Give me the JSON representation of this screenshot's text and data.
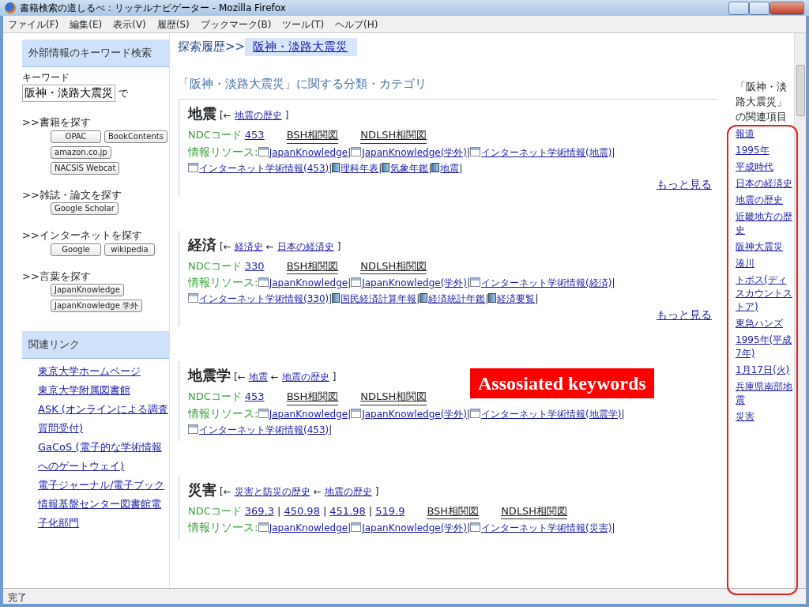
{
  "window": {
    "title": "書籍検索の道しるべ：リッテルナビゲーター - Mozilla Firefox"
  },
  "menu": [
    "ファイル(F)",
    "編集(E)",
    "表示(V)",
    "履歴(S)",
    "ブックマーク(B)",
    "ツール(T)",
    "ヘルプ(H)"
  ],
  "sidebar": {
    "search_heading": "外部情報のキーワード検索",
    "keyword_label": "キーワード",
    "keyword_value": "阪神・淡路大震災",
    "keyword_suffix": "で",
    "sections": [
      {
        "heading": ">>書籍を探す",
        "buttons": [
          "OPAC",
          "BookContents",
          "amazon.co.jp",
          "NACSIS Webcat"
        ]
      },
      {
        "heading": ">>雑誌・論文を探す",
        "buttons": [
          "Google Scholar"
        ]
      },
      {
        "heading": ">>インターネットを探す",
        "buttons": [
          "Google",
          "wikipedia"
        ]
      },
      {
        "heading": ">>言葉を探す",
        "buttons": [
          "JapanKnowledge",
          "JapanKnowledge 学外"
        ]
      }
    ],
    "links_heading": "関連リンク",
    "links": [
      "東京大学ホームページ",
      "東京大学附属図書館",
      "ASK (オンラインによる調査質問受付)",
      "GaCoS (電子的な学術情報へのゲートウェイ)",
      "電子ジャーナル/電子ブック",
      "情報基盤センター図書館電子化部門"
    ]
  },
  "main": {
    "breadcrumb_label": "探索履歴>>",
    "breadcrumb_current": "阪神・淡路大震災",
    "section_title": "「阪神・淡路大震災」に関する分類・カテゴリ",
    "path_open": "[←",
    "path_arrow": "←",
    "path_close": "]",
    "separator": "|",
    "categories": [
      {
        "title": "地震",
        "path": [
          "地震の歴史"
        ],
        "ndc_label": "NDCコード",
        "ndc_codes": [
          "453"
        ],
        "bsh": "BSH相関図",
        "ndlsh": "NDLSH相関図",
        "resources_label": "情報リソース:",
        "resources": [
          {
            "kind": "web",
            "label": "JapanKnowledge"
          },
          {
            "kind": "web",
            "label": "JapanKnowledge(学外)"
          },
          {
            "kind": "web",
            "label": "インターネット学術情報(地震)"
          },
          {
            "kind": "web",
            "label": "インターネット学術情報(453)"
          },
          {
            "kind": "book",
            "label": "理科年表"
          },
          {
            "kind": "book",
            "label": "気象年鑑"
          },
          {
            "kind": "book",
            "label": "地震"
          }
        ],
        "more": "もっと見る"
      },
      {
        "title": "経済",
        "path": [
          "経済史",
          "日本の経済史"
        ],
        "ndc_label": "NDCコード",
        "ndc_codes": [
          "330"
        ],
        "bsh": "BSH相関図",
        "ndlsh": "NDLSH相関図",
        "resources_label": "情報リソース:",
        "resources": [
          {
            "kind": "web",
            "label": "JapanKnowledge"
          },
          {
            "kind": "web",
            "label": "JapanKnowledge(学外)"
          },
          {
            "kind": "web",
            "label": "インターネット学術情報(経済)"
          },
          {
            "kind": "web",
            "label": "インターネット学術情報(330)"
          },
          {
            "kind": "book",
            "label": "国民経済計算年報"
          },
          {
            "kind": "book",
            "label": "経済統計年鑑"
          },
          {
            "kind": "book",
            "label": "経済要覧"
          }
        ],
        "more": "もっと見る"
      },
      {
        "title": "地震学",
        "path": [
          "地震",
          "地震の歴史"
        ],
        "ndc_label": "NDCコード",
        "ndc_codes": [
          "453"
        ],
        "bsh": "BSH相関図",
        "ndlsh": "NDLSH相関図",
        "resources_label": "情報リソース:",
        "resources": [
          {
            "kind": "web",
            "label": "JapanKnowledge"
          },
          {
            "kind": "web",
            "label": "JapanKnowledge(学外)"
          },
          {
            "kind": "web",
            "label": "インターネット学術情報(地震学)"
          },
          {
            "kind": "web",
            "label": "インターネット学術情報(453)"
          }
        ]
      },
      {
        "title": "災害",
        "path": [
          "災害と防災の歴史",
          "地震の歴史"
        ],
        "ndc_label": "NDCコード",
        "ndc_codes": [
          "369.3",
          "450.98",
          "451.98",
          "519.9"
        ],
        "bsh": "BSH相関図",
        "ndlsh": "NDLSH相関図",
        "resources_label": "情報リソース:",
        "resources": [
          {
            "kind": "web",
            "label": "JapanKnowledge"
          },
          {
            "kind": "web",
            "label": "JapanKnowledge(学外)"
          },
          {
            "kind": "web",
            "label": "インターネット学術情報(災害)"
          }
        ]
      }
    ]
  },
  "related": {
    "heading": "「阪神・淡路大震災」の関連項目",
    "items": [
      "報道",
      "1995年",
      "平成時代",
      "日本の経済史",
      "地震の歴史",
      "近畿地方の歴史",
      "阪神大震災",
      "湊川",
      "トボス(ディスカウントストア)",
      "東急ハンズ",
      "1995年(平成7年)",
      "1月17日(火)",
      "兵庫県南部地震",
      "災害"
    ]
  },
  "annotation": {
    "label": "Assosiated keywords"
  },
  "status_bar": "完了"
}
